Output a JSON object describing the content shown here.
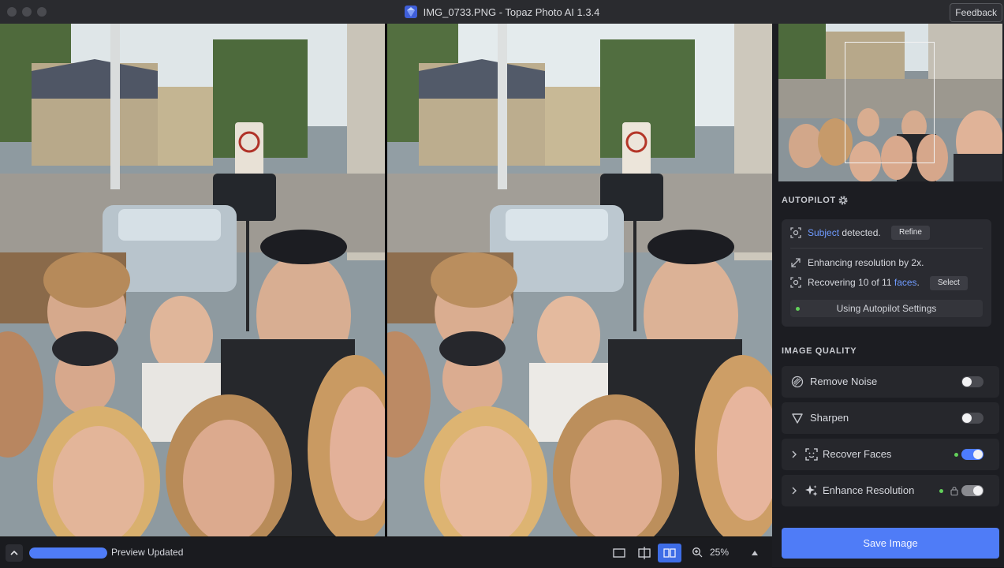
{
  "window": {
    "title": "IMG_0733.PNG - Topaz Photo AI 1.3.4",
    "feedback_label": "Feedback"
  },
  "colors": {
    "accent": "#4f7cf7",
    "toggle_on": "#4d7cff",
    "status_dot": "#62d05a",
    "panel_bg": "#1c1d22"
  },
  "autopilot": {
    "title": "AUTOPILOT",
    "subject_word": "Subject",
    "subject_rest": " detected.",
    "refine_label": "Refine",
    "resolution_text": "Enhancing resolution by 2x.",
    "faces_prefix": "Recovering 10 of 11 ",
    "faces_word": "faces",
    "faces_suffix": ".",
    "select_label": "Select",
    "settings_label": "Using Autopilot Settings"
  },
  "image_quality": {
    "title": "IMAGE QUALITY",
    "items": [
      {
        "label": "Remove Noise",
        "icon": "remove-noise-icon",
        "enabled": false
      },
      {
        "label": "Sharpen",
        "icon": "sharpen-icon",
        "enabled": false
      },
      {
        "label": "Recover Faces",
        "icon": "recover-faces-icon",
        "enabled": true
      },
      {
        "label": "Enhance Resolution",
        "icon": "enhance-resolution-icon",
        "enabled": true
      }
    ]
  },
  "save_label": "Save Image",
  "status": {
    "text": "Preview Updated",
    "progress": 1.0
  },
  "zoom": {
    "level": "25%"
  },
  "view_modes": [
    "single-view",
    "split-view",
    "side-by-side-view"
  ],
  "active_view": "side-by-side-view"
}
